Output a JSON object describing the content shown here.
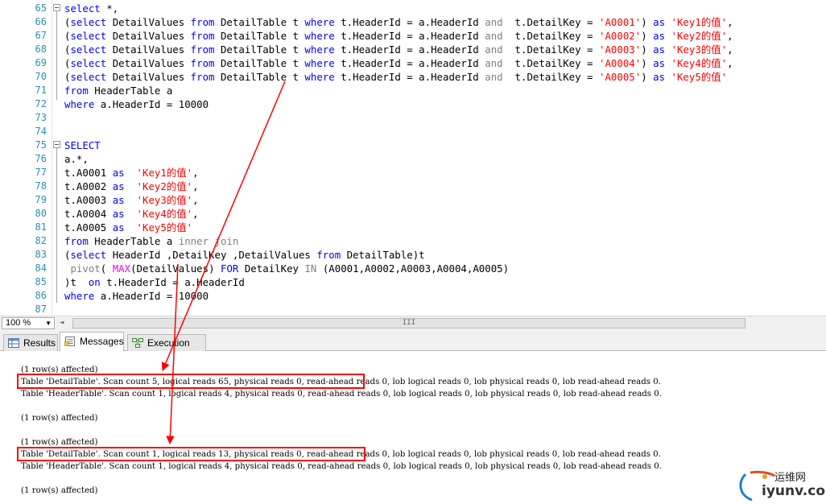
{
  "editor": {
    "lines": [
      {
        "n": "65",
        "fold": true,
        "segments": [
          {
            "c": "kw",
            "t": "select"
          },
          {
            "c": "",
            "t": " *,"
          }
        ]
      },
      {
        "n": "66",
        "segments": [
          {
            "c": "",
            "t": "("
          },
          {
            "c": "kw",
            "t": "select"
          },
          {
            "c": "",
            "t": " DetailValues "
          },
          {
            "c": "kw",
            "t": "from"
          },
          {
            "c": "",
            "t": " DetailTable t "
          },
          {
            "c": "kw",
            "t": "where"
          },
          {
            "c": "",
            "t": " t.HeaderId = a.HeaderId "
          },
          {
            "c": "gray",
            "t": "and"
          },
          {
            "c": "",
            "t": "  t.DetailKey = "
          },
          {
            "c": "str",
            "t": "'A0001'"
          },
          {
            "c": "",
            "t": ") "
          },
          {
            "c": "kw",
            "t": "as"
          },
          {
            "c": "",
            "t": " "
          },
          {
            "c": "str",
            "t": "'Key1的值'"
          },
          {
            "c": "",
            "t": ","
          }
        ]
      },
      {
        "n": "67",
        "segments": [
          {
            "c": "",
            "t": "("
          },
          {
            "c": "kw",
            "t": "select"
          },
          {
            "c": "",
            "t": " DetailValues "
          },
          {
            "c": "kw",
            "t": "from"
          },
          {
            "c": "",
            "t": " DetailTable t "
          },
          {
            "c": "kw",
            "t": "where"
          },
          {
            "c": "",
            "t": " t.HeaderId = a.HeaderId "
          },
          {
            "c": "gray",
            "t": "and"
          },
          {
            "c": "",
            "t": "  t.DetailKey = "
          },
          {
            "c": "str",
            "t": "'A0002'"
          },
          {
            "c": "",
            "t": ") "
          },
          {
            "c": "kw",
            "t": "as"
          },
          {
            "c": "",
            "t": " "
          },
          {
            "c": "str",
            "t": "'Key2的值'"
          },
          {
            "c": "",
            "t": ","
          }
        ]
      },
      {
        "n": "68",
        "segments": [
          {
            "c": "",
            "t": "("
          },
          {
            "c": "kw",
            "t": "select"
          },
          {
            "c": "",
            "t": " DetailValues "
          },
          {
            "c": "kw",
            "t": "from"
          },
          {
            "c": "",
            "t": " DetailTable t "
          },
          {
            "c": "kw",
            "t": "where"
          },
          {
            "c": "",
            "t": " t.HeaderId = a.HeaderId "
          },
          {
            "c": "gray",
            "t": "and"
          },
          {
            "c": "",
            "t": "  t.DetailKey = "
          },
          {
            "c": "str",
            "t": "'A0003'"
          },
          {
            "c": "",
            "t": ") "
          },
          {
            "c": "kw",
            "t": "as"
          },
          {
            "c": "",
            "t": " "
          },
          {
            "c": "str",
            "t": "'Key3的值'"
          },
          {
            "c": "",
            "t": ","
          }
        ]
      },
      {
        "n": "69",
        "segments": [
          {
            "c": "",
            "t": "("
          },
          {
            "c": "kw",
            "t": "select"
          },
          {
            "c": "",
            "t": " DetailValues "
          },
          {
            "c": "kw",
            "t": "from"
          },
          {
            "c": "",
            "t": " DetailTable t "
          },
          {
            "c": "kw",
            "t": "where"
          },
          {
            "c": "",
            "t": " t.HeaderId = a.HeaderId "
          },
          {
            "c": "gray",
            "t": "and"
          },
          {
            "c": "",
            "t": "  t.DetailKey = "
          },
          {
            "c": "str",
            "t": "'A0004'"
          },
          {
            "c": "",
            "t": ") "
          },
          {
            "c": "kw",
            "t": "as"
          },
          {
            "c": "",
            "t": " "
          },
          {
            "c": "str",
            "t": "'Key4的值'"
          },
          {
            "c": "",
            "t": ","
          }
        ]
      },
      {
        "n": "70",
        "segments": [
          {
            "c": "",
            "t": "("
          },
          {
            "c": "kw",
            "t": "select"
          },
          {
            "c": "",
            "t": " DetailValues "
          },
          {
            "c": "kw",
            "t": "from"
          },
          {
            "c": "",
            "t": " DetailTable t "
          },
          {
            "c": "kw",
            "t": "where"
          },
          {
            "c": "",
            "t": " t.HeaderId = a.HeaderId "
          },
          {
            "c": "gray",
            "t": "and"
          },
          {
            "c": "",
            "t": "  t.DetailKey = "
          },
          {
            "c": "str",
            "t": "'A0005'"
          },
          {
            "c": "",
            "t": ") "
          },
          {
            "c": "kw",
            "t": "as"
          },
          {
            "c": "",
            "t": " "
          },
          {
            "c": "str",
            "t": "'Key5的值'"
          }
        ]
      },
      {
        "n": "71",
        "segments": [
          {
            "c": "kw",
            "t": "from"
          },
          {
            "c": "",
            "t": " HeaderTable a"
          }
        ]
      },
      {
        "n": "72",
        "segments": [
          {
            "c": "kw",
            "t": "where"
          },
          {
            "c": "",
            "t": " a.HeaderId = 10000"
          }
        ]
      },
      {
        "n": "73",
        "segments": []
      },
      {
        "n": "74",
        "segments": []
      },
      {
        "n": "75",
        "fold": true,
        "segments": [
          {
            "c": "kw",
            "t": "SELECT"
          }
        ]
      },
      {
        "n": "76",
        "segments": [
          {
            "c": "",
            "t": "a.*,"
          }
        ]
      },
      {
        "n": "77",
        "segments": [
          {
            "c": "",
            "t": "t.A0001 "
          },
          {
            "c": "kw",
            "t": "as"
          },
          {
            "c": "",
            "t": "  "
          },
          {
            "c": "str",
            "t": "'Key1的值'"
          },
          {
            "c": "",
            "t": ","
          }
        ]
      },
      {
        "n": "78",
        "segments": [
          {
            "c": "",
            "t": "t.A0002 "
          },
          {
            "c": "kw",
            "t": "as"
          },
          {
            "c": "",
            "t": "  "
          },
          {
            "c": "str",
            "t": "'Key2的值'"
          },
          {
            "c": "",
            "t": ","
          }
        ]
      },
      {
        "n": "79",
        "segments": [
          {
            "c": "",
            "t": "t.A0003 "
          },
          {
            "c": "kw",
            "t": "as"
          },
          {
            "c": "",
            "t": "  "
          },
          {
            "c": "str",
            "t": "'Key3的值'"
          },
          {
            "c": "",
            "t": ","
          }
        ]
      },
      {
        "n": "80",
        "segments": [
          {
            "c": "",
            "t": "t.A0004 "
          },
          {
            "c": "kw",
            "t": "as"
          },
          {
            "c": "",
            "t": "  "
          },
          {
            "c": "str",
            "t": "'Key4的值'"
          },
          {
            "c": "",
            "t": ","
          }
        ]
      },
      {
        "n": "81",
        "segments": [
          {
            "c": "",
            "t": "t.A0005 "
          },
          {
            "c": "kw",
            "t": "as"
          },
          {
            "c": "",
            "t": "  "
          },
          {
            "c": "str",
            "t": "'Key5的值'"
          }
        ]
      },
      {
        "n": "82",
        "segments": [
          {
            "c": "kw",
            "t": "from"
          },
          {
            "c": "",
            "t": " HeaderTable a "
          },
          {
            "c": "gray",
            "t": "inner join"
          }
        ]
      },
      {
        "n": "83",
        "segments": [
          {
            "c": "",
            "t": "("
          },
          {
            "c": "kw",
            "t": "select"
          },
          {
            "c": "",
            "t": " HeaderId ,DetailKey ,DetailValues "
          },
          {
            "c": "kw",
            "t": "from"
          },
          {
            "c": "",
            "t": " DetailTable)t"
          }
        ]
      },
      {
        "n": "84",
        "segments": [
          {
            "c": "",
            "t": " "
          },
          {
            "c": "gray",
            "t": "pivot"
          },
          {
            "c": "",
            "t": "( "
          },
          {
            "c": "fn",
            "t": "MAX"
          },
          {
            "c": "",
            "t": "(DetailValues) "
          },
          {
            "c": "kw",
            "t": "FOR"
          },
          {
            "c": "",
            "t": " DetailKey "
          },
          {
            "c": "gray",
            "t": "IN"
          },
          {
            "c": "",
            "t": " (A0001,A0002,A0003,A0004,A0005)"
          }
        ]
      },
      {
        "n": "85",
        "segments": [
          {
            "c": "",
            "t": ")t  "
          },
          {
            "c": "kw",
            "t": "on"
          },
          {
            "c": "",
            "t": " t.HeaderId = a.HeaderId"
          }
        ]
      },
      {
        "n": "86",
        "segments": [
          {
            "c": "kw",
            "t": "where"
          },
          {
            "c": "",
            "t": " a.HeaderId = 10000"
          }
        ]
      },
      {
        "n": "87",
        "segments": []
      }
    ]
  },
  "statusbar": {
    "zoom": "100 %",
    "zoom_arrow": "▼",
    "scroll_left": "◄",
    "thumb_grip": "III"
  },
  "tabs": {
    "results": "Results",
    "messages": "Messages",
    "execution_plan": "Execution plan"
  },
  "messages": {
    "lines": [
      "(1 row(s) affected)",
      "Table 'DetailTable'. Scan count 5, logical reads 65, physical reads 0, read-ahead reads 0, lob logical reads 0, lob physical reads 0, lob read-ahead reads 0.",
      "Table 'HeaderTable'. Scan count 1, logical reads 4, physical reads 0, read-ahead reads 0, lob logical reads 0, lob physical reads 0, lob read-ahead reads 0.",
      "",
      "(1 row(s) affected)",
      "",
      "(1 row(s) affected)",
      "Table 'DetailTable'. Scan count 1, logical reads 13, physical reads 0, read-ahead reads 0, lob logical reads 0, lob physical reads 0, lob read-ahead reads 0.",
      "Table 'HeaderTable'. Scan count 1, logical reads 4, physical reads 0, read-ahead reads 0, lob logical reads 0, lob physical reads 0, lob read-ahead reads 0.",
      "",
      "(1 row(s) affected)"
    ]
  },
  "annotations": {
    "color": "#ff0000"
  },
  "watermark": {
    "cn": "运维网",
    "url": "iyunv.com"
  }
}
